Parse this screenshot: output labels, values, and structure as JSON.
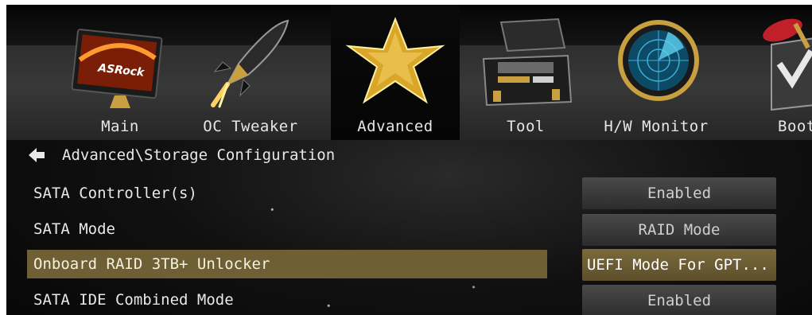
{
  "tabs": [
    {
      "label": "Main",
      "icon": "monitor-icon",
      "selected": false
    },
    {
      "label": "OC Tweaker",
      "icon": "rocket-icon",
      "selected": false
    },
    {
      "label": "Advanced",
      "icon": "star-icon",
      "selected": true
    },
    {
      "label": "Tool",
      "icon": "toolbox-icon",
      "selected": false
    },
    {
      "label": "H/W Monitor",
      "icon": "radar-icon",
      "selected": false
    },
    {
      "label": "Boot",
      "icon": "boot-icon",
      "selected": false
    }
  ],
  "logo_text": "ASRock",
  "breadcrumb": {
    "back_icon": "back-arrow-icon",
    "path": "Advanced\\Storage Configuration"
  },
  "settings": [
    {
      "label": "SATA Controller(s)",
      "value": "Enabled",
      "selected": false
    },
    {
      "label": "SATA Mode",
      "value": "RAID Mode",
      "selected": false
    },
    {
      "label": "Onboard RAID 3TB+ Unlocker",
      "value": "UEFI Mode For GPT...",
      "selected": true
    },
    {
      "label": "SATA IDE Combined Mode",
      "value": "Enabled",
      "selected": false
    }
  ],
  "colors": {
    "selected_row": "#6e5f35",
    "accent_gold": "#c9a040",
    "text": "#e8e8e8",
    "value_bg": "#3a3a3a"
  }
}
